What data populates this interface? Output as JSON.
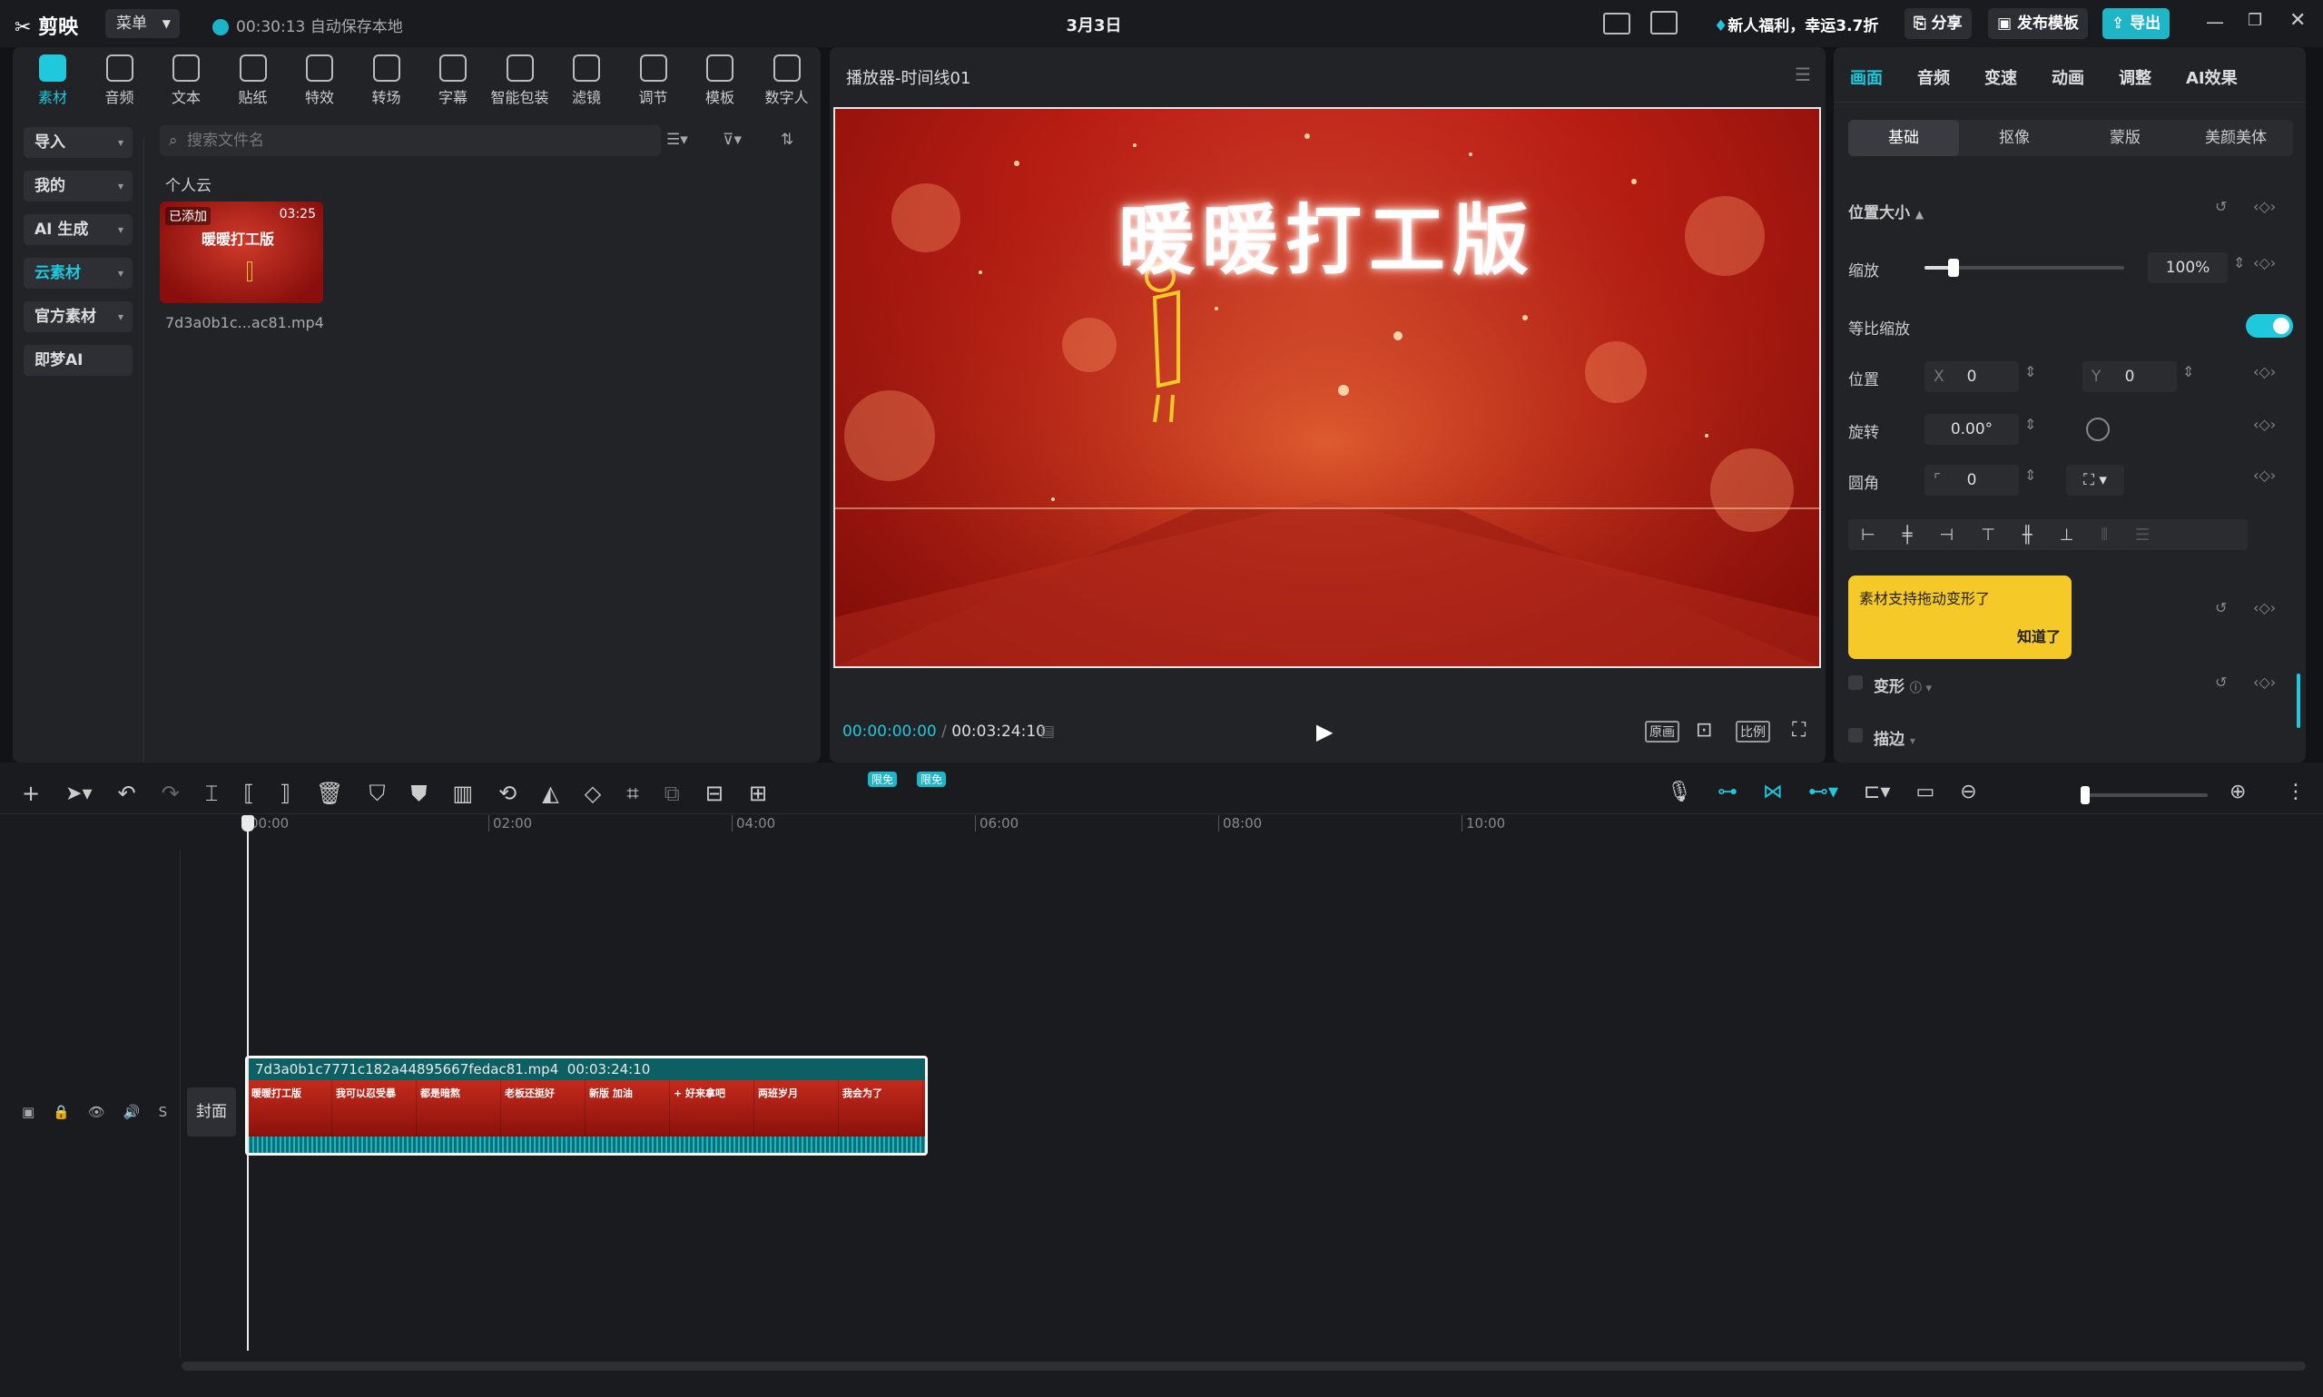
{
  "app": {
    "name": "剪映",
    "menu": "菜单",
    "autosave": "00:30:13 自动保存本地",
    "title": "3月3日",
    "promo": "新人福利，幸运3.7折",
    "share": "分享",
    "publish_template": "发布模板",
    "export": "导出"
  },
  "toolbar": [
    {
      "label": "素材",
      "icon": "media-icon",
      "active": true
    },
    {
      "label": "音频",
      "icon": "audio-icon"
    },
    {
      "label": "文本",
      "icon": "text-icon"
    },
    {
      "label": "贴纸",
      "icon": "sticker-icon"
    },
    {
      "label": "特效",
      "icon": "effects-icon"
    },
    {
      "label": "转场",
      "icon": "transition-icon"
    },
    {
      "label": "字幕",
      "icon": "subtitle-icon"
    },
    {
      "label": "智能包装",
      "icon": "smart-package-icon"
    },
    {
      "label": "滤镜",
      "icon": "filter-icon"
    },
    {
      "label": "调节",
      "icon": "adjust-icon"
    },
    {
      "label": "模板",
      "icon": "template-icon"
    },
    {
      "label": "数字人",
      "icon": "digital-human-icon"
    }
  ],
  "sidebar": [
    {
      "label": "导入",
      "dropdown": true
    },
    {
      "label": "我的",
      "dropdown": true
    },
    {
      "label": "AI 生成",
      "dropdown": true
    },
    {
      "label": "云素材",
      "dropdown": true,
      "active": true
    },
    {
      "label": "官方素材",
      "dropdown": true
    },
    {
      "label": "即梦AI",
      "dropdown": false
    }
  ],
  "media": {
    "search_placeholder": "搜索文件名",
    "section": "个人云",
    "item": {
      "badge": "已添加",
      "duration": "03:25",
      "name": "7d3a0b1c...ac81.mp4",
      "thumb_title": "暖暖打工版"
    }
  },
  "player": {
    "title": "播放器-时间线01",
    "video_title": "暖暖打工版",
    "current": "00:00:00:00",
    "total": "00:03:24:10",
    "btn_original": "原画",
    "btn_ratio": "比例"
  },
  "inspector": {
    "tabs": [
      "画面",
      "音频",
      "变速",
      "动画",
      "调整",
      "AI效果"
    ],
    "subtabs": [
      "基础",
      "抠像",
      "蒙版",
      "美颜美体"
    ],
    "section_pos": "位置大小",
    "scale_label": "缩放",
    "scale_value": "100%",
    "scale": 1.0,
    "uniform_label": "等比缩放",
    "pos_label": "位置",
    "x_label": "X",
    "x_value": "0",
    "y_label": "Y",
    "y_value": "0",
    "rot_label": "旋转",
    "rot_value": "0.00°",
    "corner_label": "圆角",
    "corner_value": "0",
    "tooltip_text": "素材支持拖动变形了",
    "tooltip_btn": "知道了",
    "transform_label": "变形",
    "stroke_label": "描边"
  },
  "timeline": {
    "badge": "限免",
    "ruler": [
      "00:00",
      "02:00",
      "04:00",
      "06:00",
      "08:00",
      "10:00"
    ],
    "clip_name": "7d3a0b1c7771c182a44895667fedac81.mp4",
    "clip_duration": "00:03:24:10",
    "cover": "封面",
    "frame_texts": [
      "暖暖打工版",
      "我可以忍受暴",
      "都是暗熬",
      "老板还挺好",
      "新版 加油",
      "+ 好来拿吧",
      "两班岁月",
      "我会为了"
    ]
  }
}
